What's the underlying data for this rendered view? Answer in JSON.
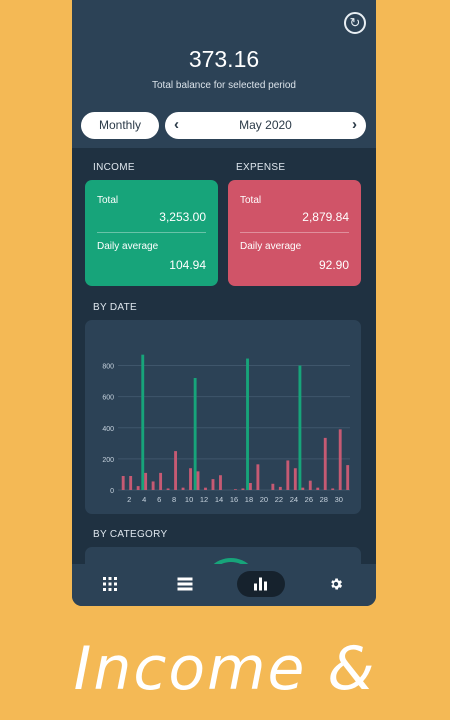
{
  "header": {
    "balance": "373.16",
    "balance_label": "Total balance for selected period",
    "sync_icon": "sync-icon"
  },
  "period": {
    "mode_label": "Monthly",
    "current_label": "May 2020",
    "prev_icon": "chevron-left-icon",
    "next_icon": "chevron-right-icon"
  },
  "income": {
    "section_label": "INCOME",
    "total_label": "Total",
    "total_value": "3,253.00",
    "avg_label": "Daily average",
    "avg_value": "104.94",
    "color": "#17a47a"
  },
  "expense": {
    "section_label": "EXPENSE",
    "total_label": "Total",
    "total_value": "2,879.84",
    "avg_label": "Daily average",
    "avg_value": "92.90",
    "color": "#d05468"
  },
  "by_date": {
    "section_label": "BY DATE"
  },
  "by_category": {
    "section_label": "BY CATEGORY"
  },
  "chart_data": {
    "type": "bar",
    "categories": [
      1,
      2,
      3,
      4,
      5,
      6,
      7,
      8,
      9,
      10,
      11,
      12,
      13,
      14,
      15,
      16,
      17,
      18,
      19,
      20,
      21,
      22,
      23,
      24,
      25,
      26,
      27,
      28,
      29,
      30,
      31
    ],
    "x_tick_labels": [
      "2",
      "4",
      "6",
      "8",
      "10",
      "12",
      "14",
      "16",
      "18",
      "20",
      "22",
      "24",
      "26",
      "28",
      "30"
    ],
    "y_ticks": [
      0,
      200,
      400,
      600,
      800
    ],
    "ylim": [
      0,
      900
    ],
    "grid": true,
    "series": [
      {
        "color": "#17a47a",
        "values": [
          0,
          0,
          0,
          870,
          0,
          0,
          0,
          0,
          0,
          0,
          720,
          0,
          0,
          0,
          0,
          0,
          0,
          845,
          0,
          0,
          0,
          0,
          0,
          0,
          800,
          0,
          0,
          0,
          0,
          0,
          0
        ]
      },
      {
        "color": "#c65a73",
        "values": [
          90,
          90,
          25,
          110,
          55,
          110,
          10,
          250,
          15,
          140,
          120,
          15,
          70,
          95,
          0,
          5,
          10,
          45,
          165,
          0,
          40,
          20,
          190,
          140,
          15,
          60,
          15,
          335,
          10,
          390,
          160
        ]
      }
    ]
  },
  "nav": {
    "items": [
      {
        "name": "dashboard",
        "icon": "grid-icon"
      },
      {
        "name": "transactions",
        "icon": "list-icon"
      },
      {
        "name": "statistics",
        "icon": "bar-chart-icon"
      },
      {
        "name": "settings",
        "icon": "gear-icon"
      }
    ],
    "active": "statistics"
  },
  "promo": {
    "text": "Income &"
  }
}
